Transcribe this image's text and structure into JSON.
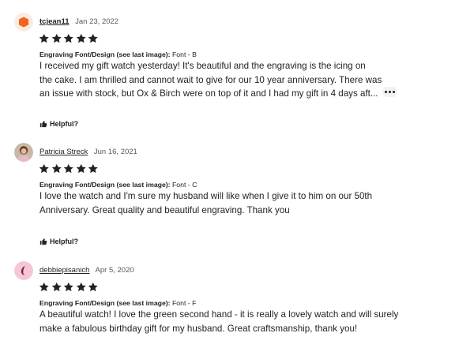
{
  "reviews": [
    {
      "username": "tcjean11",
      "date": "Jan 23, 2022",
      "rating": 5,
      "engraving_label": "Engraving Font/Design (see last image):",
      "engraving_value": "Font - B",
      "text_lines": [
        "I received my gift watch yesterday! It's beautiful and the engraving is the icing on",
        "the cake. I am thrilled and cannot wait to give for our 10 year anniversary. There was",
        "an issue with stock, but Ox & Birch were on top of it and I had my gift in 4 days aft..."
      ],
      "helpful_label": "Helpful?",
      "avatar_color": "#f1641e"
    },
    {
      "username": "Patricia Streck",
      "date": "Jun 16, 2021",
      "rating": 5,
      "engraving_label": "Engraving Font/Design (see last image):",
      "engraving_value": "Font - C",
      "text_lines": [
        "I love the watch and I'm sure my husband will like when I give it to him on our 50th",
        "Anniversary. Great quality and beautiful engraving. Thank you"
      ],
      "helpful_label": "Helpful?"
    },
    {
      "username": "debbiepisanich",
      "date": "Apr 5, 2020",
      "rating": 5,
      "engraving_label": "Engraving Font/Design (see last image):",
      "engraving_value": "Font - F",
      "text_lines": [
        "A beautiful watch! I love the green second hand - it is really a lovely watch and will surely",
        "make a fabulous birthday gift for my husband. Great craftsmanship, thank you!"
      ],
      "avatar_color": "#f6c5d6"
    }
  ],
  "colors": {
    "star": "#222222",
    "text": "#222222",
    "meta": "#595959"
  }
}
